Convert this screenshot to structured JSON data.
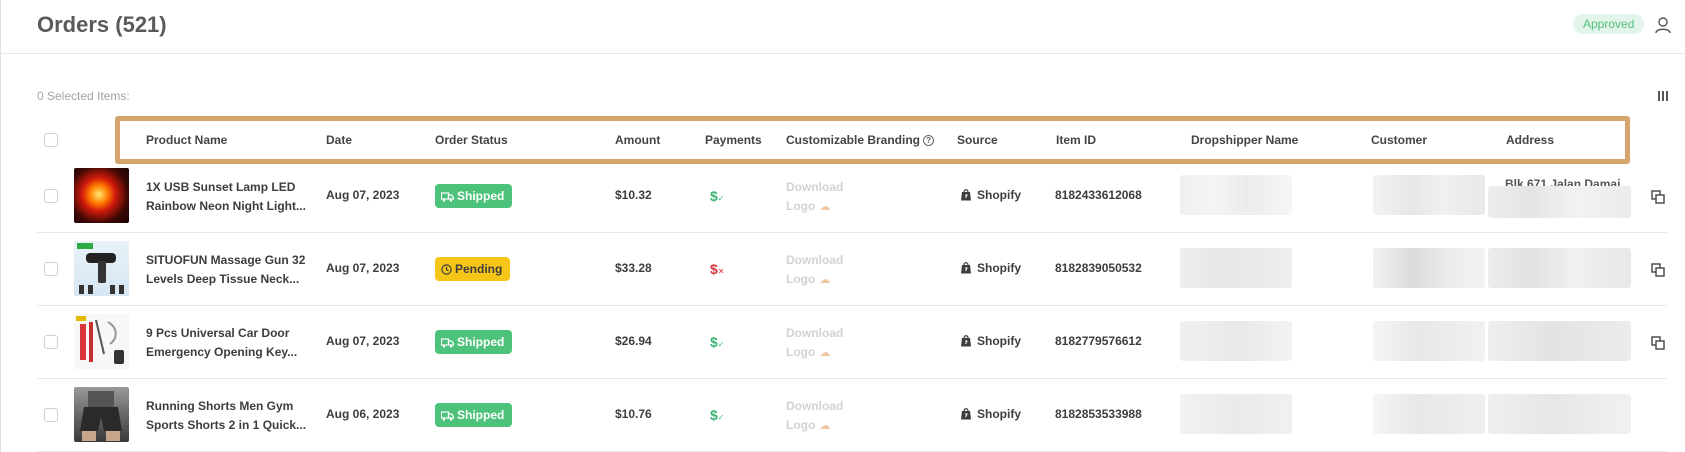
{
  "header": {
    "title": "Orders (521)",
    "status": "Approved"
  },
  "toolbar": {
    "selected_items": "0 Selected Items:"
  },
  "table": {
    "columns": [
      "Product Name",
      "Date",
      "Order Status",
      "Amount",
      "Payments",
      "Customizable Branding",
      "Source",
      "Item ID",
      "Dropshipper Name",
      "Customer",
      "Address"
    ],
    "rows": [
      {
        "product_line1": "1X USB Sunset Lamp LED",
        "product_line2": "Rainbow Neon Night Light...",
        "date": "Aug 07, 2023",
        "status": "Shipped",
        "amount": "$10.32",
        "payment": "$",
        "download_line1": "Download",
        "download_line2": "Logo",
        "source": "Shopify",
        "item_id": "8182433612068",
        "address": "Blk 671 Jalan Damai"
      },
      {
        "product_line1": "SITUOFUN Massage Gun 32",
        "product_line2": "Levels Deep Tissue Neck...",
        "date": "Aug 07, 2023",
        "status": "Pending",
        "amount": "$33.28",
        "payment": "$",
        "download_line1": "Download",
        "download_line2": "Logo",
        "source": "Shopify",
        "item_id": "8182839050532",
        "address": ""
      },
      {
        "product_line1": "9 Pcs Universal Car Door",
        "product_line2": "Emergency Opening Key...",
        "date": "Aug 07, 2023",
        "status": "Shipped",
        "amount": "$26.94",
        "payment": "$",
        "download_line1": "Download",
        "download_line2": "Logo",
        "source": "Shopify",
        "item_id": "8182779576612",
        "address": ""
      },
      {
        "product_line1": "Running Shorts Men Gym",
        "product_line2": "Sports Shorts 2 in 1 Quick...",
        "date": "Aug 06, 2023",
        "status": "Shipped",
        "amount": "$10.76",
        "payment": "$",
        "download_line1": "Download",
        "download_line2": "Logo",
        "source": "Shopify",
        "item_id": "8182853533988",
        "address": ""
      }
    ]
  },
  "colors": {
    "shipped": "#4dc27a",
    "pending": "#f5c518",
    "paid": "#3cb371",
    "unpaid": "#d9363e",
    "highlight": "#d6a46d"
  },
  "icons": [
    "user-icon",
    "columns-icon",
    "help-icon",
    "truck-icon",
    "clock-icon",
    "dollar-check-icon",
    "dollar-x-icon",
    "cloud-upload-icon",
    "shopify-bag-icon",
    "copy-icon"
  ]
}
